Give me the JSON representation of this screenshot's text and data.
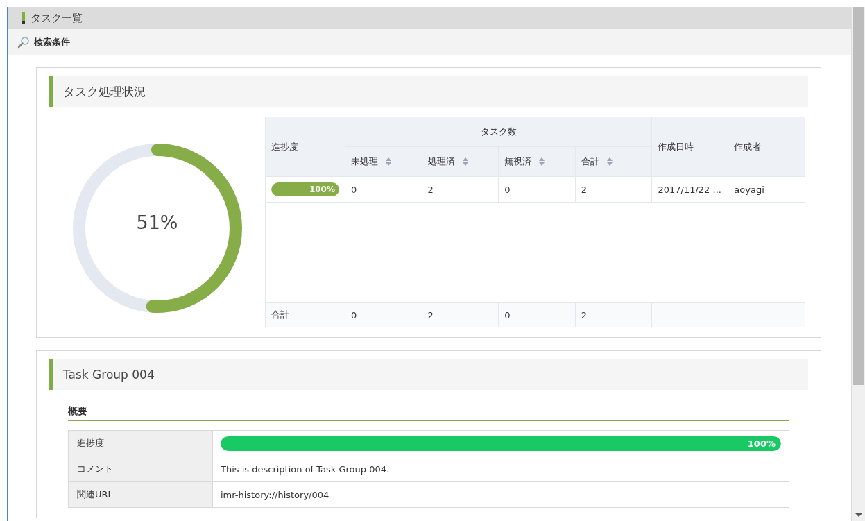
{
  "header": {
    "title": "タスク一覧"
  },
  "search_bar": {
    "label": "検索条件"
  },
  "status_panel": {
    "title": "タスク処理状況",
    "donut": {
      "level": 0.51,
      "label": "51%"
    },
    "table": {
      "progress_header": "進捗度",
      "group_header": "タスク数",
      "columns": [
        {
          "label": "未処理",
          "sortable": true
        },
        {
          "label": "処理済",
          "sortable": true
        },
        {
          "label": "無視済",
          "sortable": true
        },
        {
          "label": "合計",
          "sortable": true
        }
      ],
      "date_header": "作成日時",
      "author_header": "作成者",
      "rows": [
        {
          "progress": {
            "level": 1,
            "label": "100%"
          },
          "cells": [
            "0",
            "2",
            "0",
            "2"
          ],
          "date": "2017/11/22 ...",
          "author": "aoyagi"
        }
      ],
      "footer": {
        "label": "合計",
        "cells": [
          "0",
          "2",
          "0",
          "2"
        ]
      }
    }
  },
  "group_panel": {
    "title": "Task Group 004",
    "section": "概要",
    "rows": [
      {
        "kind": "progress",
        "label": "進捗度",
        "level": 1,
        "value": "100%"
      },
      {
        "kind": "text",
        "label": "コメント",
        "value": "This is description of Task Group 004."
      },
      {
        "kind": "text",
        "label": "関連URI",
        "value": "imr-history://history/004"
      }
    ]
  }
}
